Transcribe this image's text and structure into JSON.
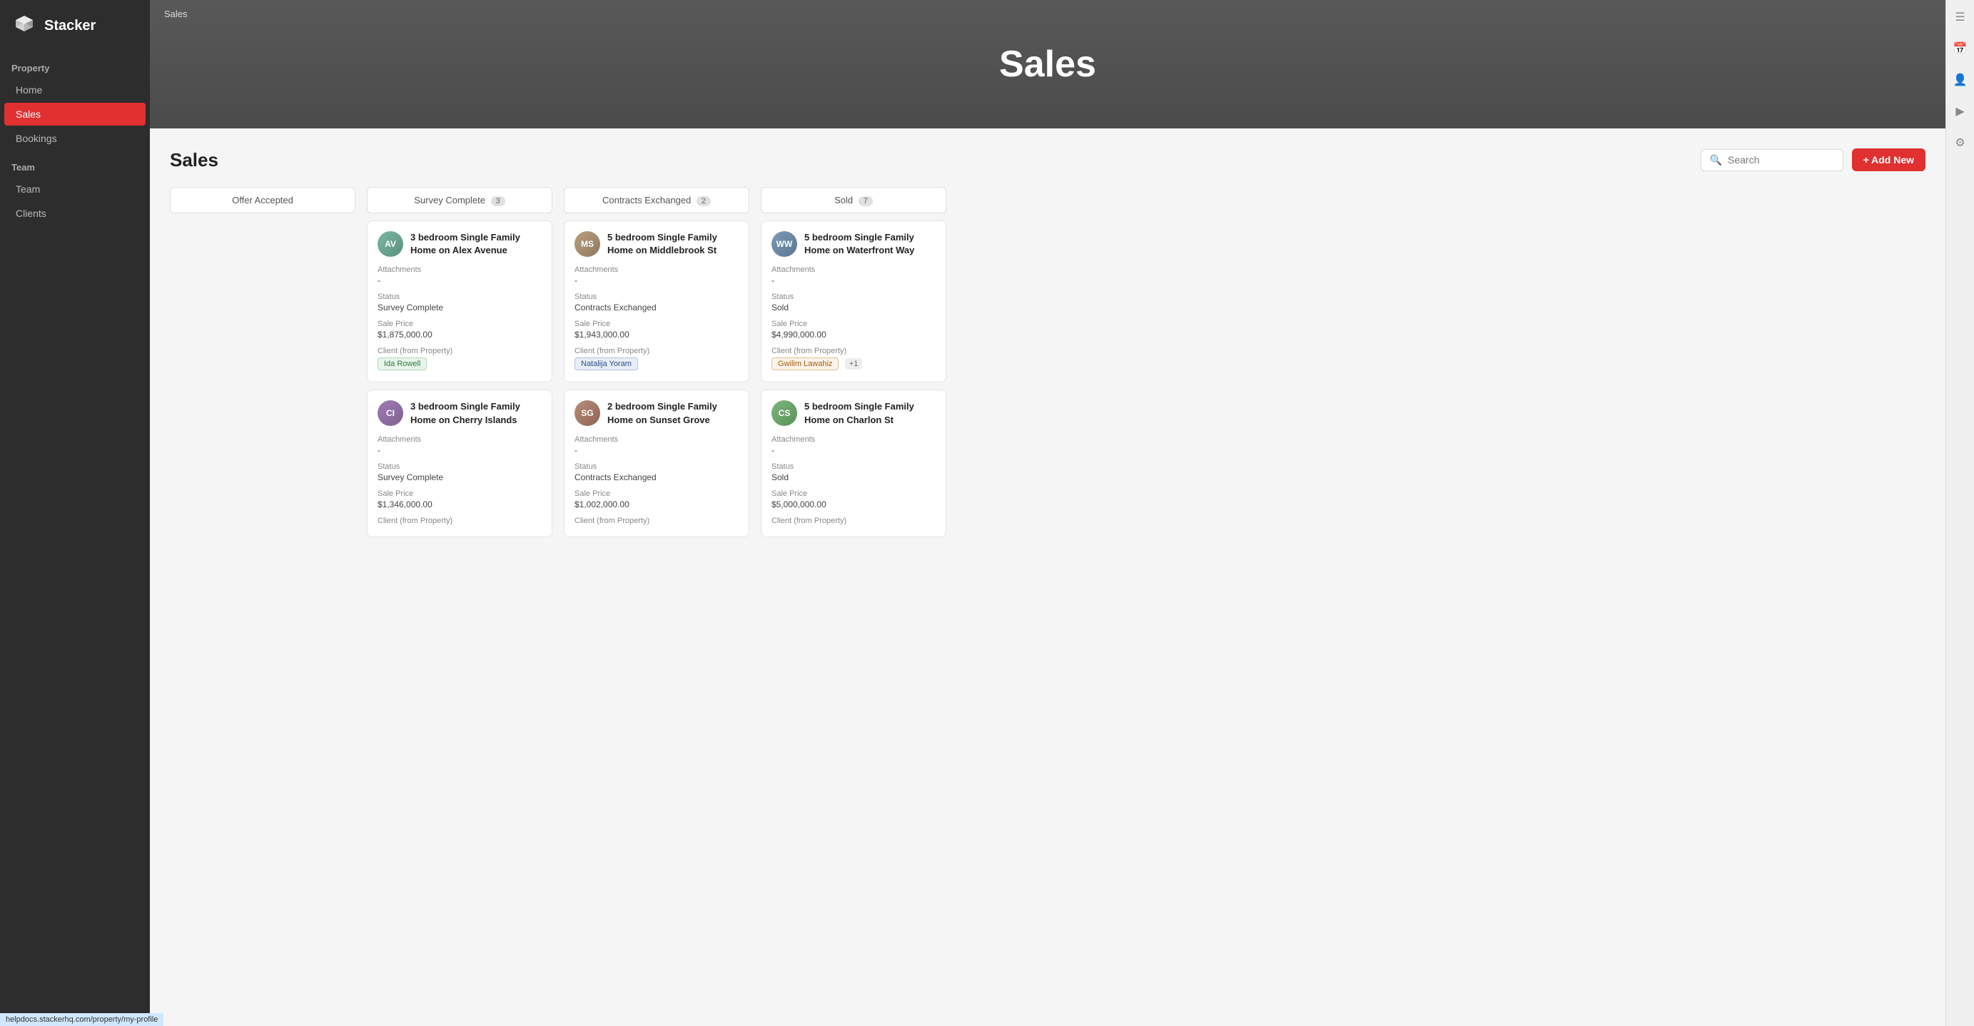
{
  "app": {
    "name": "Stacker"
  },
  "sidebar": {
    "section_property": "Property",
    "section_team": "Team",
    "items_property": [
      {
        "label": "Home",
        "active": false,
        "id": "home"
      },
      {
        "label": "Sales",
        "active": true,
        "id": "sales"
      },
      {
        "label": "Bookings",
        "active": false,
        "id": "bookings"
      }
    ],
    "items_team": [
      {
        "label": "Team",
        "active": false,
        "id": "team"
      },
      {
        "label": "Clients",
        "active": false,
        "id": "clients"
      }
    ]
  },
  "hero": {
    "breadcrumb": "Sales",
    "title": "Sales"
  },
  "content": {
    "title": "Sales",
    "search_placeholder": "Search",
    "add_new_label": "+ Add New"
  },
  "columns": [
    {
      "id": "offer-accepted",
      "label": "Offer Accepted",
      "badge": null,
      "cards": []
    },
    {
      "id": "survey-complete",
      "label": "Survey Complete",
      "badge": "3",
      "cards": [
        {
          "id": "card-1",
          "title": "3 bedroom Single Family Home on Alex Avenue",
          "thumb_class": "card-thumb-alex",
          "thumb_initials": "AV",
          "attachments_label": "Attachments",
          "attachments_value": "-",
          "status_label": "Status",
          "status_value": "Survey Complete",
          "sale_price_label": "Sale Price",
          "sale_price_value": "$1,875,000.00",
          "client_label": "Client (from Property)",
          "clients": [
            {
              "name": "Ida Rowell",
              "color": "green"
            }
          ]
        },
        {
          "id": "card-4",
          "title": "3 bedroom Single Family Home on Cherry Islands",
          "thumb_class": "card-thumb-cherry",
          "thumb_initials": "CI",
          "attachments_label": "Attachments",
          "attachments_value": "-",
          "status_label": "Status",
          "status_value": "Survey Complete",
          "sale_price_label": "Sale Price",
          "sale_price_value": "$1,346,000.00",
          "client_label": "Client (from Property)",
          "clients": []
        }
      ]
    },
    {
      "id": "contracts-exchanged",
      "label": "Contracts Exchanged",
      "badge": "2",
      "cards": [
        {
          "id": "card-2",
          "title": "5 bedroom Single Family Home on Middlebrook St",
          "thumb_class": "card-thumb-middlebrook",
          "thumb_initials": "MS",
          "attachments_label": "Attachments",
          "attachments_value": "-",
          "status_label": "Status",
          "status_value": "Contracts Exchanged",
          "sale_price_label": "Sale Price",
          "sale_price_value": "$1,943,000.00",
          "client_label": "Client (from Property)",
          "clients": [
            {
              "name": "Natalija Yoram",
              "color": "blue"
            }
          ]
        },
        {
          "id": "card-5",
          "title": "2 bedroom Single Family Home on Sunset Grove",
          "thumb_class": "card-thumb-sunset",
          "thumb_initials": "SG",
          "attachments_label": "Attachments",
          "attachments_value": "-",
          "status_label": "Status",
          "status_value": "Contracts Exchanged",
          "sale_price_label": "Sale Price",
          "sale_price_value": "$1,002,000.00",
          "client_label": "Client (from Property)",
          "clients": []
        }
      ]
    },
    {
      "id": "sold",
      "label": "Sold",
      "badge": "7",
      "cards": [
        {
          "id": "card-3",
          "title": "5 bedroom Single Family Home on Waterfront Way",
          "thumb_class": "card-thumb-waterfront",
          "thumb_initials": "WW",
          "attachments_label": "Attachments",
          "attachments_value": "-",
          "status_label": "Status",
          "status_value": "Sold",
          "sale_price_label": "Sale Price",
          "sale_price_value": "$4,990,000.00",
          "client_label": "Client (from Property)",
          "clients": [
            {
              "name": "Gwilim Lawahiz",
              "color": "orange"
            },
            {
              "name": "+1",
              "color": "badge"
            }
          ]
        },
        {
          "id": "card-6",
          "title": "5 bedroom Single Family Home on Charlon St",
          "thumb_class": "card-thumb-charlon",
          "thumb_initials": "CS",
          "attachments_label": "Attachments",
          "attachments_value": "-",
          "status_label": "Status",
          "status_value": "Sold",
          "sale_price_label": "Sale Price",
          "sale_price_value": "$5,000,000.00",
          "client_label": "Client (from Property)",
          "clients": []
        }
      ]
    }
  ],
  "url_bar": "helpdocs.stackerhq.com/property/my-profile"
}
